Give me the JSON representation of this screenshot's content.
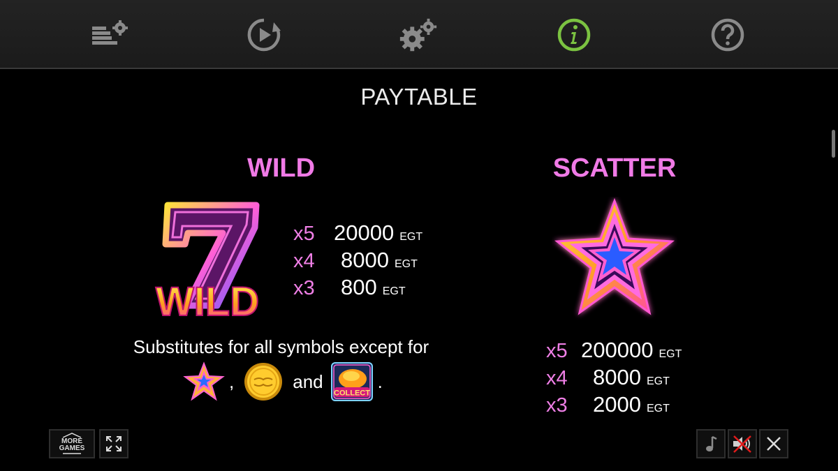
{
  "toolbar": {
    "items": [
      {
        "id": "bet-settings",
        "icon": "bet-settings-icon"
      },
      {
        "id": "autoplay",
        "icon": "autoplay-icon"
      },
      {
        "id": "settings",
        "icon": "gear-icon"
      },
      {
        "id": "info",
        "icon": "info-icon",
        "active": true
      },
      {
        "id": "help",
        "icon": "help-icon"
      }
    ]
  },
  "page": {
    "title": "PAYTABLE"
  },
  "wild": {
    "heading": "WILD",
    "symbol_text": "WILD",
    "pays": [
      {
        "mult": "x5",
        "value": "20000",
        "currency": "EGT"
      },
      {
        "mult": "x4",
        "value": "8000",
        "currency": "EGT"
      },
      {
        "mult": "x3",
        "value": "800",
        "currency": "EGT"
      }
    ],
    "description": "Substitutes for all symbols except for",
    "separator": ",",
    "and": "and",
    "end": ".",
    "collect_label": "COLLECT"
  },
  "scatter": {
    "heading": "SCATTER",
    "pays": [
      {
        "mult": "x5",
        "value": "200000",
        "currency": "EGT"
      },
      {
        "mult": "x4",
        "value": "8000",
        "currency": "EGT"
      },
      {
        "mult": "x3",
        "value": "2000",
        "currency": "EGT"
      }
    ]
  },
  "bottom": {
    "more_games_line1": "MORE",
    "more_games_line2": "GAMES"
  },
  "colors": {
    "accent_pink": "#f07ae6",
    "info_active": "#7bc241",
    "icon_gray": "#8a8a8a"
  }
}
